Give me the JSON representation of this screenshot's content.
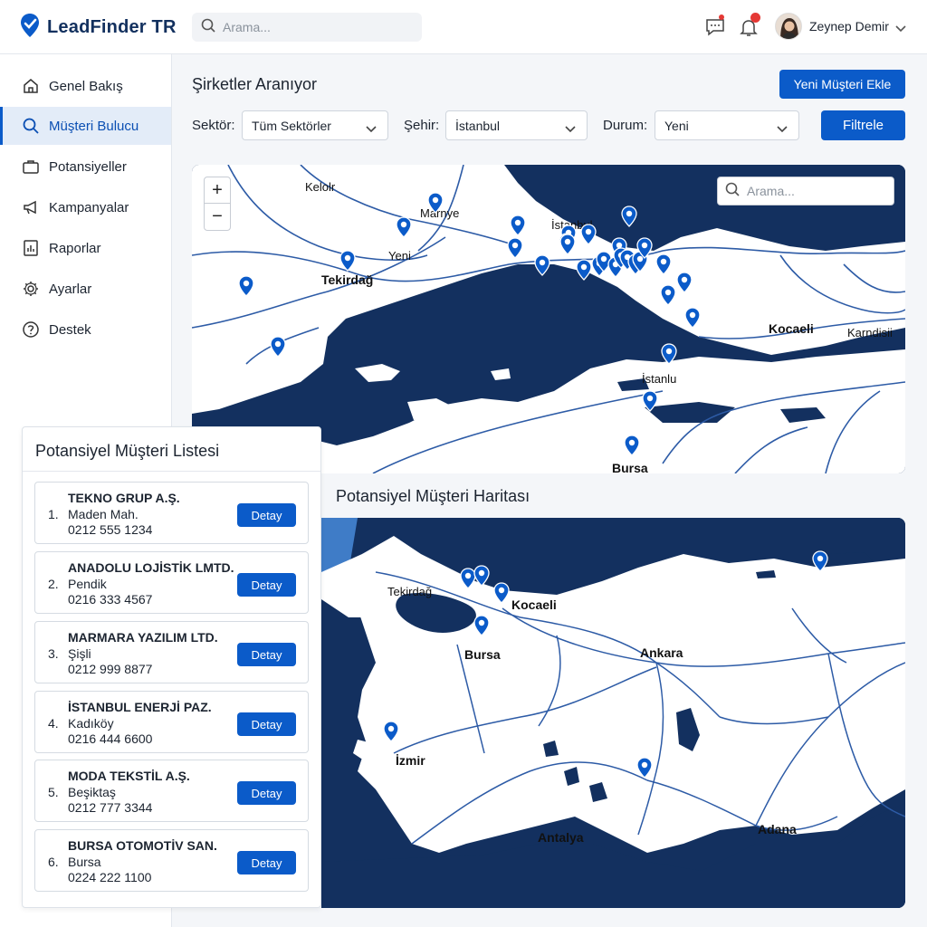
{
  "app": {
    "name": "LeadFinder TR"
  },
  "header": {
    "search_placeholder": "Arama...",
    "user_name": "Zeynep Demir"
  },
  "sidebar": {
    "items": [
      {
        "label": "Genel Bakış",
        "icon": "home-icon",
        "active": false
      },
      {
        "label": "Müşteri Bulucu",
        "icon": "search-icon",
        "active": true
      },
      {
        "label": "Potansiyeller",
        "icon": "briefcase-icon",
        "active": false
      },
      {
        "label": "Kampanyalar",
        "icon": "megaphone-icon",
        "active": false
      },
      {
        "label": "Raporlar",
        "icon": "chart-icon",
        "active": false
      },
      {
        "label": "Ayarlar",
        "icon": "gear-icon",
        "active": false
      },
      {
        "label": "Destek",
        "icon": "help-icon",
        "active": false
      }
    ]
  },
  "main": {
    "title": "Şirketler Aranıyor",
    "add_button": "Yeni Müşteri Ekle",
    "filters": {
      "sector_label": "Sektör:",
      "sector_value": "Tüm Sektörler",
      "city_label": "Şehir:",
      "city_value": "İstanbul",
      "status_label": "Durum:",
      "status_value": "Yeni",
      "filter_button": "Filtrele"
    }
  },
  "map_top": {
    "search_placeholder": "Arama...",
    "zoom_in": "+",
    "zoom_out": "−",
    "labels": [
      "Kelolr",
      "Marnye",
      "İstanbul",
      "Yeni",
      "Tekirdağ",
      "Kocaeli",
      "Karndisii",
      "İstanlu",
      "Bursa"
    ]
  },
  "map_bottom": {
    "title": "Potansiyel Müşteri Haritası",
    "labels": [
      "Tekirdağ",
      "Kocaeli",
      "Bursa",
      "Ankara",
      "İzmir",
      "Antalya",
      "Adana"
    ]
  },
  "lead_list": {
    "title": "Potansiyel Müşteri Listesi",
    "detail_label": "Detay",
    "items": [
      {
        "num": "1.",
        "name": "TEKNO GRUP A.Ş.",
        "address": "Maden Mah.",
        "phone": "0212 555 1234"
      },
      {
        "num": "2.",
        "name": "ANADOLU LOJİSTİK LMTD.",
        "address": "Pendik",
        "phone": "0216 333 4567"
      },
      {
        "num": "3.",
        "name": "MARMARA YAZILIM LTD.",
        "address": "Şişli",
        "phone": "0212 999 8877"
      },
      {
        "num": "4.",
        "name": "İSTANBUL ENERJİ PAZ.",
        "address": "Kadıköy",
        "phone": "0216 444 6600"
      },
      {
        "num": "5.",
        "name": "MODA TEKSTİL A.Ş.",
        "address": "Beşiktaş",
        "phone": "0212 777 3344"
      },
      {
        "num": "6.",
        "name": "BURSA OTOMOTİV SAN.",
        "address": "Bursa",
        "phone": "0224 222 1100"
      }
    ]
  },
  "colors": {
    "primary": "#0b5bc9",
    "sea": "#13305f",
    "land": "#ffffff",
    "road": "#2d5ba6",
    "notification": "#e53935"
  }
}
